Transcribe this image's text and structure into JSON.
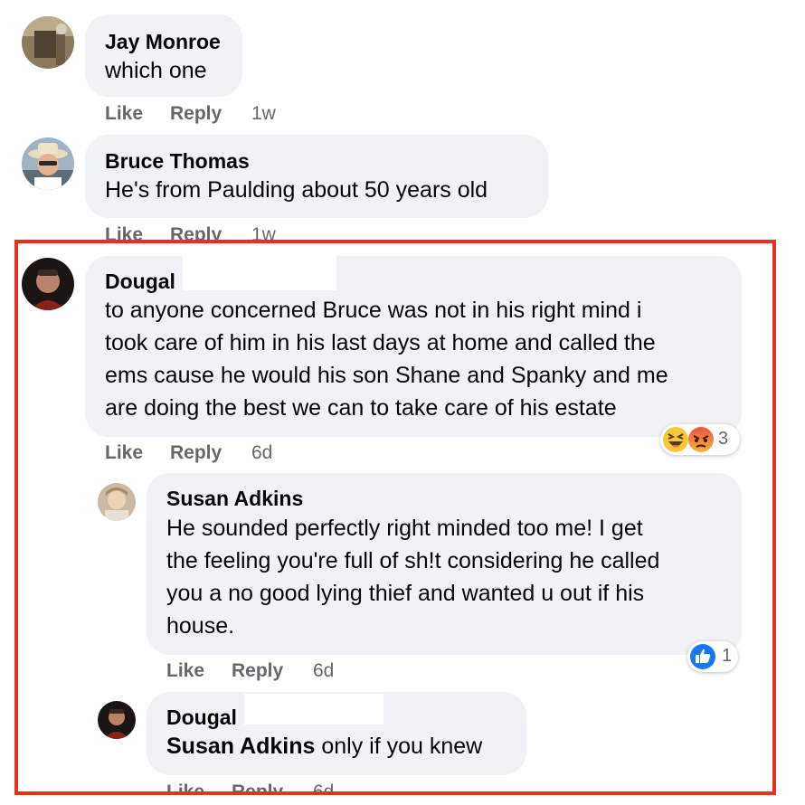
{
  "colors": {
    "bubble": "#f0f2f5",
    "meta_text": "#65676b",
    "highlight": "#e8301f",
    "like_blue": "#1877f2"
  },
  "comments": [
    {
      "author": "Jay Monroe",
      "text": "which one",
      "like": "Like",
      "reply": "Reply",
      "time": "1w"
    },
    {
      "author": "Bruce Thomas",
      "text": "He's from Paulding about 50 years old",
      "like": "Like",
      "reply": "Reply",
      "time": "1w"
    },
    {
      "author": "Dougal",
      "text_lines": [
        "to anyone concerned Bruce was not in his right mind i",
        "took care of him in his last days at home and called the",
        "ems cause he would his son Shane and Spanky and me",
        "are doing the best we can to take care of his estate"
      ],
      "like": "Like",
      "reply": "Reply",
      "time": "6d",
      "reactions": {
        "icons": [
          "haha-icon",
          "angry-icon"
        ],
        "count": "3"
      }
    },
    {
      "author": "Susan Adkins",
      "text_lines": [
        "He sounded perfectly right minded too me! I get",
        "the feeling you're full of sh!t considering he called",
        "you a no good lying thief and wanted u out if his",
        "house."
      ],
      "like": "Like",
      "reply": "Reply",
      "time": "6d",
      "reactions": {
        "icons": [
          "like-reaction-icon"
        ],
        "count": "1"
      }
    },
    {
      "author": "Dougal",
      "mention": "Susan Adkins",
      "text": " only if you knew",
      "like": "Like",
      "reply": "Reply",
      "time": "6d"
    }
  ]
}
